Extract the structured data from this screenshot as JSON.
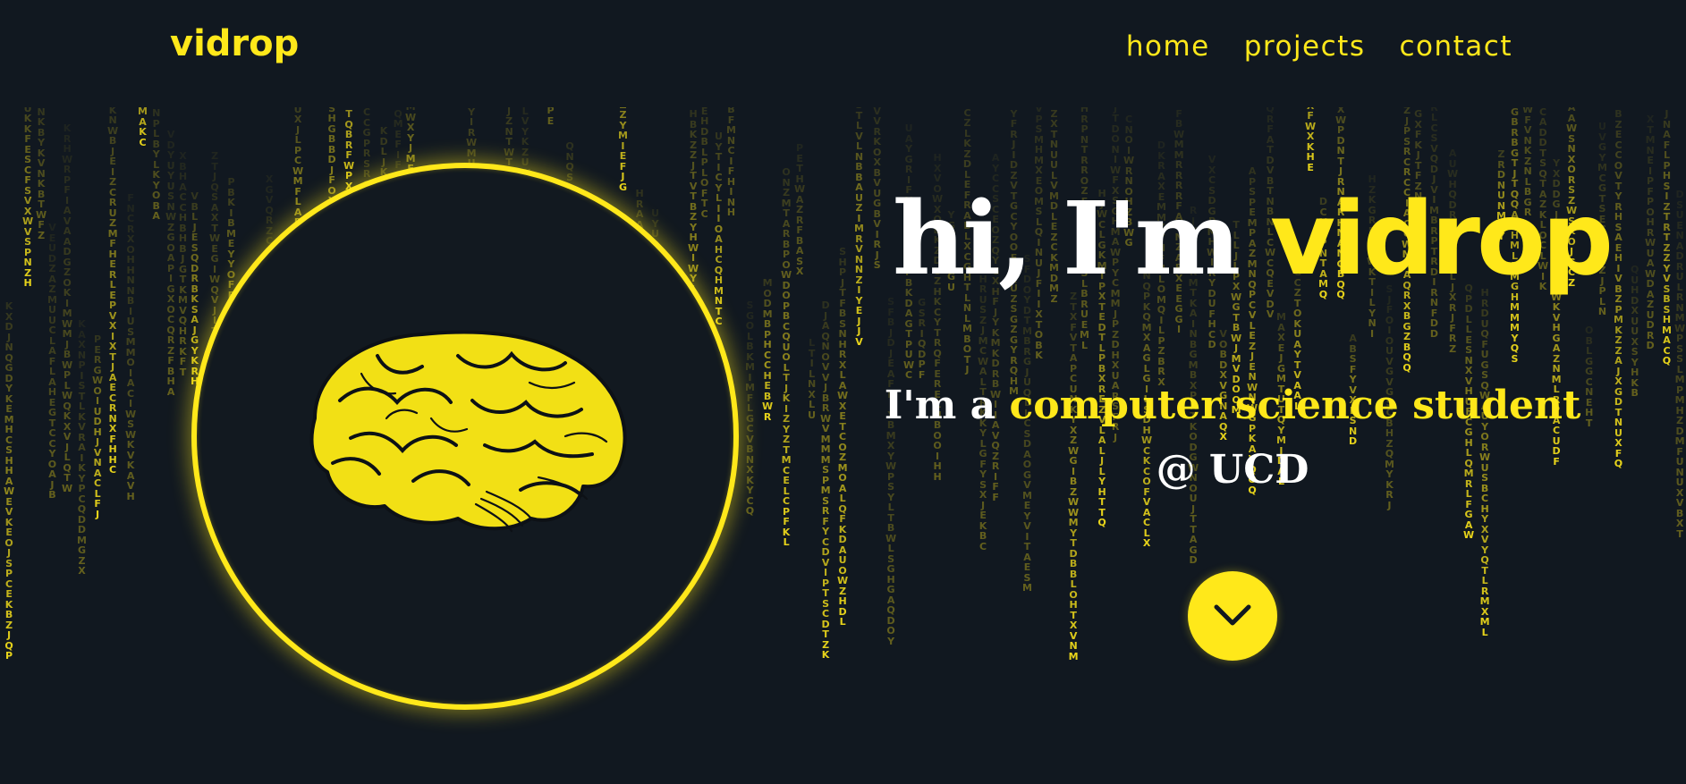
{
  "header": {
    "logo": "vidrop",
    "nav": [
      {
        "label": "home"
      },
      {
        "label": "projects"
      },
      {
        "label": "contact"
      }
    ]
  },
  "hero": {
    "title_prefix": "hi, I'm",
    "title_name": "vidrop",
    "subtitle_prefix": "I'm a",
    "subtitle_highlight": "computer science student",
    "subtitle_line2": "@ UCD"
  },
  "theme": {
    "accent": "#ffe81a",
    "background": "#111820",
    "text": "#ffffff"
  },
  "icons": {
    "avatar": "brain-icon",
    "scroll": "chevron-down-icon"
  }
}
